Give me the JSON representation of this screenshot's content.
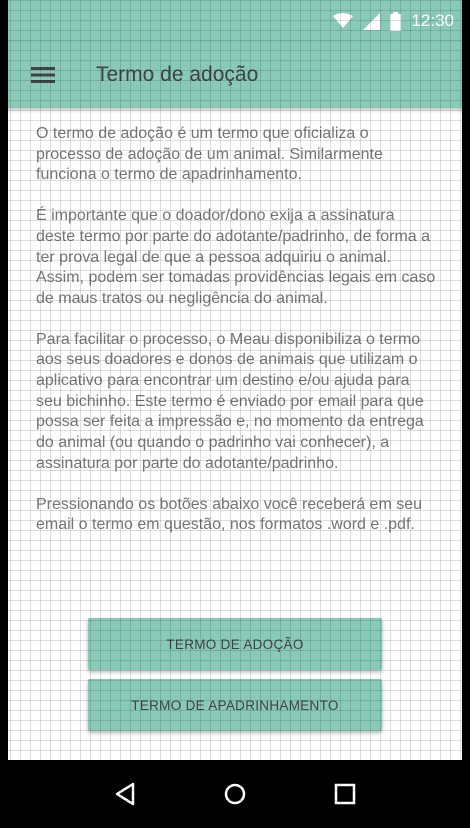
{
  "status_bar": {
    "time": "12:30",
    "icons": [
      "wifi-icon",
      "signal-icon",
      "battery-icon"
    ]
  },
  "app_bar": {
    "title": "Termo de adoção",
    "menu_icon": "hamburger-menu-icon"
  },
  "content": {
    "paragraphs": [
      "O termo de adoção é um termo que oficializa o processo de adoção de um animal. Similarmente funciona o termo de apadrinhamento.",
      "É importante que o doador/dono exija a assinatura deste termo por parte do adotante/padrinho, de forma a ter prova legal de que a pessoa adquiriu o animal. Assim, podem ser tomadas providências legais em caso de maus tratos ou negligência do animal.",
      "Para facilitar o processo, o Meau disponibiliza o termo aos seus doadores e donos de animais que utilizam o aplicativo para encontrar um destino e/ou ajuda para seu bichinho. Este termo é enviado por email para que possa ser feita a impressão e, no momento da entrega do animal (ou quando o padrinho vai conhecer), a assinatura por parte do adotante/padrinho.",
      "Pressionando os botões abaixo você receberá em seu email o termo em questão, nos formatos .word e .pdf."
    ]
  },
  "buttons": {
    "adocao_label": "TERMO DE ADOÇÃO",
    "apadrinhamento_label": "TERMO DE APADRINHAMENTO"
  },
  "nav_bar": {
    "icons": [
      "back-icon",
      "home-icon",
      "recents-icon"
    ]
  },
  "colors": {
    "accent": "#88c9b8",
    "title_text": "#434343",
    "body_text": "#757575",
    "nav_background": "#000000"
  }
}
